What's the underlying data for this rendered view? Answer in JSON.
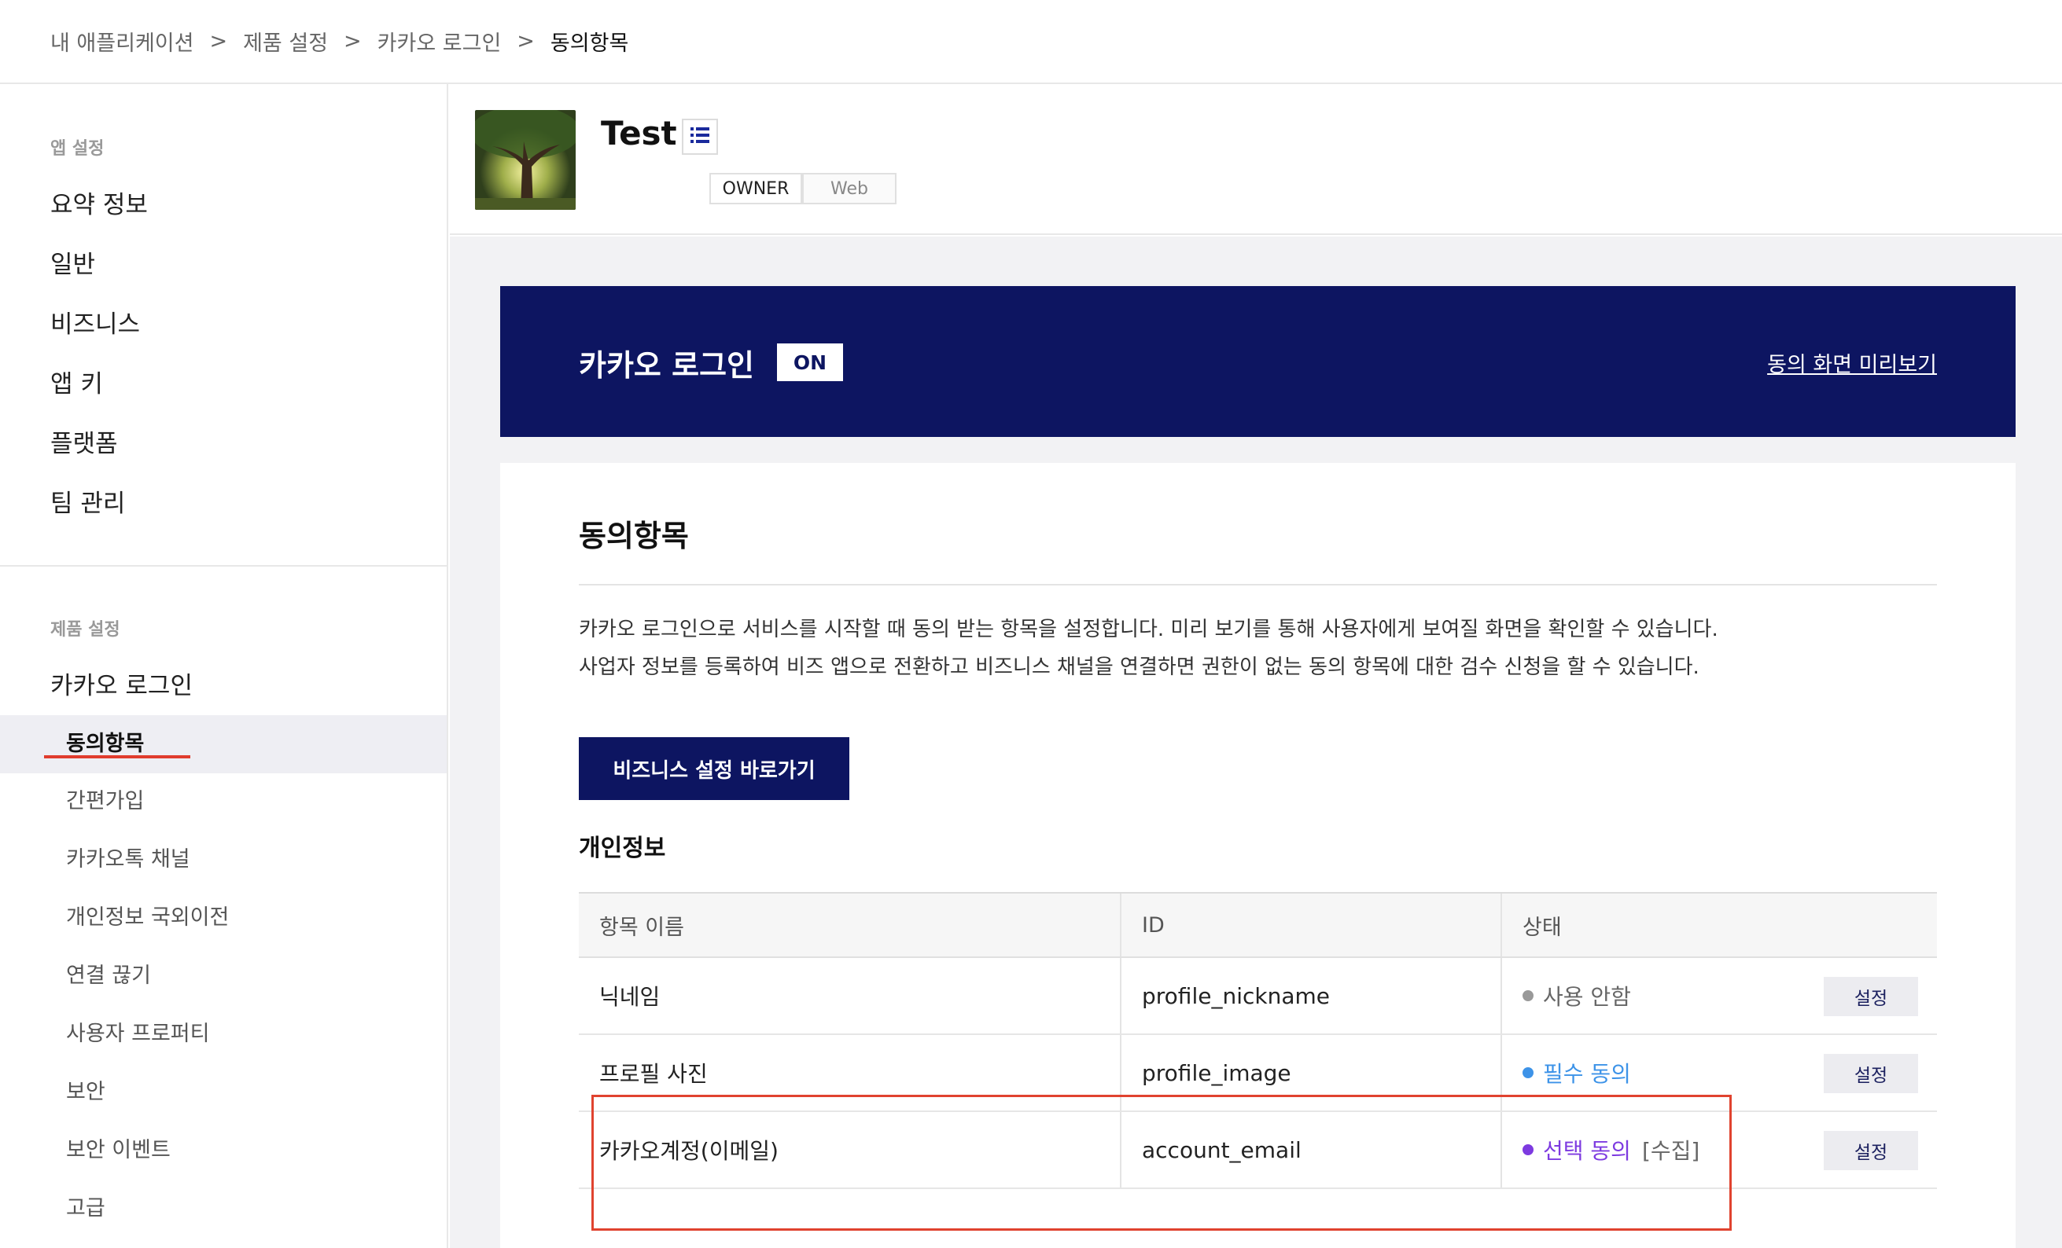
{
  "breadcrumb": {
    "items": [
      "내 애플리케이션",
      "제품 설정",
      "카카오 로그인"
    ],
    "separator": ">",
    "current": "동의항목"
  },
  "sidebar": {
    "app_section_title": "앱 설정",
    "app_items": [
      "요약 정보",
      "일반",
      "비즈니스",
      "앱 키",
      "플랫폼",
      "팀 관리"
    ],
    "product_section_title": "제품 설정",
    "product_parent": "카카오 로그인",
    "product_active": "동의항목",
    "product_subitems": [
      "간편가입",
      "카카오톡 채널",
      "개인정보 국외이전",
      "연결 끊기",
      "사용자 프로퍼티",
      "보안",
      "보안 이벤트",
      "고급"
    ]
  },
  "app": {
    "name": "Test",
    "tags": [
      "OWNER",
      "Web"
    ]
  },
  "banner": {
    "title": "카카오 로그인",
    "status": "ON",
    "preview_link": "동의 화면 미리보기"
  },
  "consent": {
    "title": "동의항목",
    "description_line1": "카카오 로그인으로 서비스를 시작할 때 동의 받는 항목을 설정합니다. 미리 보기를 통해 사용자에게 보여질 화면을 확인할 수 있습니다.",
    "description_line2": "사업자 정보를 등록하여 비즈 앱으로 전환하고 비즈니스 채널을 연결하면 권한이 없는 동의 항목에 대한 검수 신청을 할 수 있습니다.",
    "biz_button": "비즈니스 설정 바로가기",
    "section_title": "개인정보",
    "columns": [
      "항목 이름",
      "ID",
      "상태"
    ],
    "rows": [
      {
        "name": "닉네임",
        "id": "profile_nickname",
        "status": "사용 안함",
        "extra": "",
        "color": "#999999",
        "action": "설정"
      },
      {
        "name": "프로필 사진",
        "id": "profile_image",
        "status": "필수 동의",
        "extra": "",
        "color": "#3d93e8",
        "action": "설정"
      },
      {
        "name": "카카오계정(이메일)",
        "id": "account_email",
        "status": "선택 동의",
        "extra": "[수집]",
        "color": "#7d3ae0",
        "action": "설정"
      }
    ]
  },
  "colors": {
    "brand_navy": "#0d1561",
    "highlight_red": "#e0432f",
    "active_underline": "#e03c2d"
  }
}
